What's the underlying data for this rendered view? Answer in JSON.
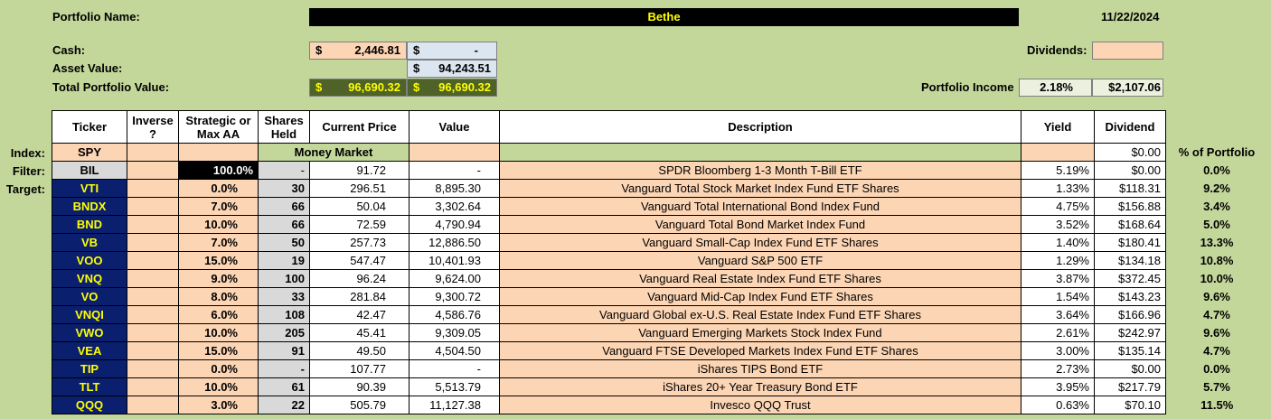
{
  "header": {
    "portfolio_name_label": "Portfolio Name:",
    "portfolio_name": "Bethe",
    "date": "11/22/2024",
    "cash_label": "Cash:",
    "cash_value": "2,446.81",
    "cash_alt_value": "-",
    "asset_value_label": "Asset Value:",
    "asset_value": "94,243.51",
    "total_label": "Total Portfolio Value:",
    "total_value_1": "96,690.32",
    "total_value_2": "96,690.32",
    "dollar": "$",
    "dividends_label": "Dividends:",
    "dividends_value": "",
    "income_label": "Portfolio Income",
    "income_pct": "2.18%",
    "income_amount": "$2,107.06"
  },
  "columns": [
    "Ticker",
    "Inverse ?",
    "Strategic or Max AA",
    "Shares Held",
    "Current Price",
    "Value",
    "Description",
    "Yield",
    "Dividend"
  ],
  "pct_header": "% of Portfolio",
  "row_labels": {
    "index": "Index:",
    "filter": "Filter:",
    "target": "Target:"
  },
  "index_row": {
    "ticker": "SPY",
    "money_market": "Money Market",
    "dividend": "$0.00"
  },
  "filter_row": {
    "ticker": "BIL",
    "aa": "100.0%",
    "shares": "-",
    "price": "91.72",
    "value": "-",
    "description": "SPDR Bloomberg 1-3 Month T-Bill ETF",
    "yield": "5.19%",
    "dividend": "$0.00",
    "pct": "0.0%"
  },
  "rows": [
    {
      "ticker": "VTI",
      "aa": "0.0%",
      "shares": "30",
      "price": "296.51",
      "value": "8,895.30",
      "description": "Vanguard Total Stock Market Index Fund ETF Shares",
      "yield": "1.33%",
      "dividend": "$118.31",
      "pct": "9.2%"
    },
    {
      "ticker": "BNDX",
      "aa": "7.0%",
      "shares": "66",
      "price": "50.04",
      "value": "3,302.64",
      "description": "Vanguard Total International Bond Index Fund",
      "yield": "4.75%",
      "dividend": "$156.88",
      "pct": "3.4%"
    },
    {
      "ticker": "BND",
      "aa": "10.0%",
      "shares": "66",
      "price": "72.59",
      "value": "4,790.94",
      "description": "Vanguard Total Bond Market Index Fund",
      "yield": "3.52%",
      "dividend": "$168.64",
      "pct": "5.0%"
    },
    {
      "ticker": "VB",
      "aa": "7.0%",
      "shares": "50",
      "price": "257.73",
      "value": "12,886.50",
      "description": "Vanguard Small-Cap Index Fund ETF Shares",
      "yield": "1.40%",
      "dividend": "$180.41",
      "pct": "13.3%"
    },
    {
      "ticker": "VOO",
      "aa": "15.0%",
      "shares": "19",
      "price": "547.47",
      "value": "10,401.93",
      "description": "Vanguard S&P 500 ETF",
      "yield": "1.29%",
      "dividend": "$134.18",
      "pct": "10.8%"
    },
    {
      "ticker": "VNQ",
      "aa": "9.0%",
      "shares": "100",
      "price": "96.24",
      "value": "9,624.00",
      "description": "Vanguard Real Estate Index Fund ETF Shares",
      "yield": "3.87%",
      "dividend": "$372.45",
      "pct": "10.0%"
    },
    {
      "ticker": "VO",
      "aa": "8.0%",
      "shares": "33",
      "price": "281.84",
      "value": "9,300.72",
      "description": "Vanguard Mid-Cap Index Fund ETF Shares",
      "yield": "1.54%",
      "dividend": "$143.23",
      "pct": "9.6%"
    },
    {
      "ticker": "VNQI",
      "aa": "6.0%",
      "shares": "108",
      "price": "42.47",
      "value": "4,586.76",
      "description": "Vanguard Global ex-U.S. Real Estate Index Fund ETF Shares",
      "yield": "3.64%",
      "dividend": "$166.96",
      "pct": "4.7%"
    },
    {
      "ticker": "VWO",
      "aa": "10.0%",
      "shares": "205",
      "price": "45.41",
      "value": "9,309.05",
      "description": "Vanguard Emerging Markets Stock Index Fund",
      "yield": "2.61%",
      "dividend": "$242.97",
      "pct": "9.6%"
    },
    {
      "ticker": "VEA",
      "aa": "15.0%",
      "shares": "91",
      "price": "49.50",
      "value": "4,504.50",
      "description": "Vanguard FTSE Developed Markets Index Fund ETF Shares",
      "yield": "3.00%",
      "dividend": "$135.14",
      "pct": "4.7%"
    },
    {
      "ticker": "TIP",
      "aa": "0.0%",
      "shares": "-",
      "price": "107.77",
      "value": "-",
      "description": "iShares TIPS Bond ETF",
      "yield": "2.73%",
      "dividend": "$0.00",
      "pct": "0.0%"
    },
    {
      "ticker": "TLT",
      "aa": "10.0%",
      "shares": "61",
      "price": "90.39",
      "value": "5,513.79",
      "description": "iShares 20+ Year Treasury Bond ETF",
      "yield": "3.95%",
      "dividend": "$217.79",
      "pct": "5.7%"
    },
    {
      "ticker": "QQQ",
      "aa": "3.0%",
      "shares": "22",
      "price": "505.79",
      "value": "11,127.38",
      "description": "Invesco QQQ Trust",
      "yield": "0.63%",
      "dividend": "$70.10",
      "pct": "11.5%"
    }
  ],
  "colors": {
    "background": "#c4d79b",
    "ticker_bg": "#0a1f6e",
    "ticker_fg": "#ffff00",
    "peach": "#fcd5b4",
    "total_bg": "#4f6228"
  }
}
